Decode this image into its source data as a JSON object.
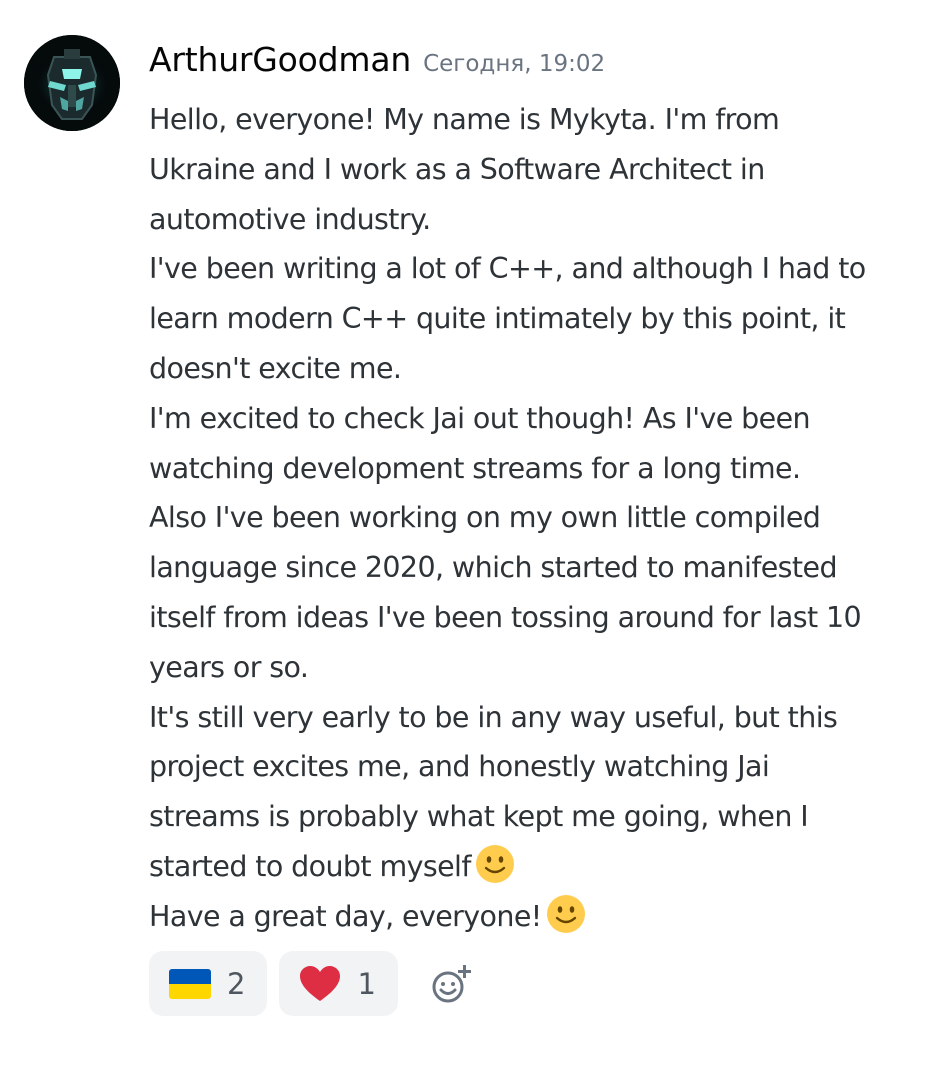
{
  "message": {
    "username": "ArthurGoodman",
    "timestamp": "Сегодня, 19:02",
    "avatar_icon": "armored-helmet-avatar",
    "lines": [
      "Hello, everyone! My name is Mykyta. I'm from",
      "Ukraine and I work as a Software Architect in",
      "automotive industry.",
      "I've been writing a lot of C++, and although I had to",
      "learn modern C++ quite intimately by this point, it",
      "doesn't excite me.",
      "I'm excited to check Jai out though! As I've been",
      "watching development streams for a long time.",
      "Also I've been working on my own little compiled",
      "language since 2020, which started to manifested",
      "itself from ideas I've been tossing around for last 10",
      "years or so.",
      "It's still very early to be in any way useful, but this",
      "project excites me, and honestly watching Jai",
      "streams is probably what kept me going, when I",
      "started to doubt myself",
      "Have a great day, everyone!"
    ],
    "emoji_icon": "slightly-smiling-face-icon"
  },
  "reactions": [
    {
      "icon": "ukraine-flag-icon",
      "count": "2"
    },
    {
      "icon": "red-heart-icon",
      "count": "1"
    }
  ],
  "add_reaction_icon": "add-reaction-icon",
  "colors": {
    "username": "#060607",
    "timestamp": "#6a7480",
    "text": "#2e3338",
    "reaction_bg": "#f2f3f5",
    "reaction_count": "#4f5660",
    "flag_blue": "#0057b7",
    "flag_yellow": "#ffd700",
    "heart": "#dd2e44",
    "emoji_face": "#ffcc4d"
  }
}
